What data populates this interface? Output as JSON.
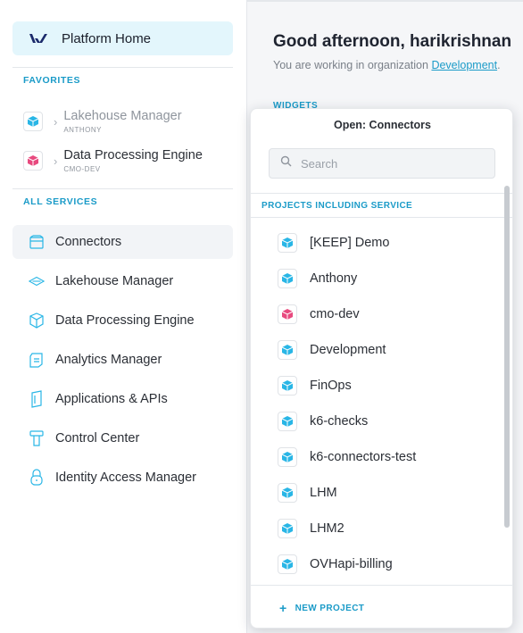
{
  "sidebar": {
    "home_label": "Platform Home",
    "favorites_label": "FAVORITES",
    "favorites": [
      {
        "name": "Lakehouse Manager",
        "sub": "ANTHONY",
        "color": "#29b6e6",
        "muted": true
      },
      {
        "name": "Data Processing Engine",
        "sub": "CMO-DEV",
        "color": "#e84a7f",
        "muted": false
      }
    ],
    "services_label": "ALL SERVICES",
    "services": [
      {
        "label": "Connectors",
        "icon": "connectors-icon",
        "active": true
      },
      {
        "label": "Lakehouse Manager",
        "icon": "lakehouse-icon"
      },
      {
        "label": "Data Processing Engine",
        "icon": "data-processing-icon"
      },
      {
        "label": "Analytics Manager",
        "icon": "analytics-icon"
      },
      {
        "label": "Applications & APIs",
        "icon": "applications-icon"
      },
      {
        "label": "Control Center",
        "icon": "control-center-icon"
      },
      {
        "label": "Identity Access Manager",
        "icon": "identity-icon"
      }
    ]
  },
  "main": {
    "greeting": "Good afternoon, harikrishnan",
    "subtitle_prefix": "You are working in organization ",
    "org_link": "Development",
    "subtitle_suffix": ".",
    "widgets_label": "WIDGETS"
  },
  "dropdown": {
    "title": "Open: Connectors",
    "search_placeholder": "Search",
    "section_label": "PROJECTS INCLUDING SERVICE",
    "projects": [
      {
        "name": "[KEEP] Demo",
        "color": "#29b6e6"
      },
      {
        "name": "Anthony",
        "color": "#29b6e6"
      },
      {
        "name": "cmo-dev",
        "color": "#e84a7f"
      },
      {
        "name": "Development",
        "color": "#29b6e6"
      },
      {
        "name": "FinOps",
        "color": "#29b6e6"
      },
      {
        "name": "k6-checks",
        "color": "#29b6e6"
      },
      {
        "name": "k6-connectors-test",
        "color": "#29b6e6"
      },
      {
        "name": "LHM",
        "color": "#29b6e6"
      },
      {
        "name": "LHM2",
        "color": "#29b6e6"
      },
      {
        "name": "OVHapi-billing",
        "color": "#29b6e6"
      }
    ],
    "new_project_label": "NEW PROJECT"
  },
  "colors": {
    "accent": "#1b9bc8",
    "home_bg": "#e3f6fc",
    "cube_blue": "#29b6e6",
    "cube_pink": "#e84a7f"
  }
}
